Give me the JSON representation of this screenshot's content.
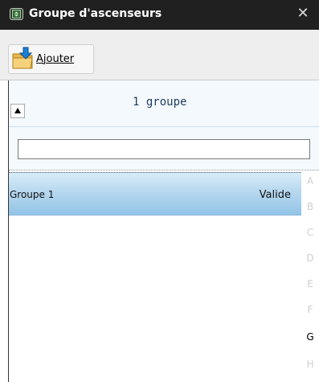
{
  "window": {
    "title": "Groupe d'ascenseurs",
    "close_glyph": "✕"
  },
  "toolbar": {
    "add_label": "Ajouter"
  },
  "group_list": {
    "count_label": "1 groupe",
    "search": {
      "value": "",
      "placeholder": ""
    },
    "rows": [
      {
        "name": "Groupe 1",
        "status": "Valide"
      }
    ]
  },
  "alpha_index": {
    "letters": [
      "A",
      "B",
      "C",
      "D",
      "E",
      "F",
      "G",
      "H"
    ],
    "active_letters": [
      "G"
    ]
  },
  "icons": {
    "title_icon": "elevator-group-icon",
    "add_icon": "folder-add-icon",
    "collapse_icon": "triangle-up-icon",
    "close_icon": "close-icon"
  },
  "colors": {
    "titlebar": "#202020",
    "row_highlight": "#b7d8ef",
    "header_tint": "#f4f9fd"
  }
}
